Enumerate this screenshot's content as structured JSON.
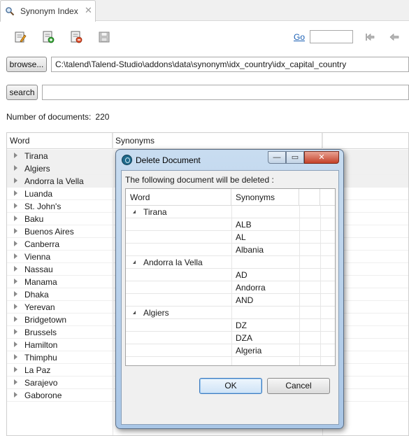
{
  "tab": {
    "title": "Synonym Index",
    "icon": "synonym-search-icon",
    "close": "✕"
  },
  "toolbar": {
    "icons": [
      "edit-document-icon",
      "add-document-icon",
      "delete-document-icon",
      "save-icon"
    ],
    "go_label": "Go",
    "go_value": "",
    "nav_icons": [
      "first-page-icon",
      "previous-page-icon"
    ]
  },
  "browse": {
    "button_label": "browse...",
    "path": "C:\\talend\\Talend-Studio\\addons\\data\\synonym\\idx_country\\idx_capital_country"
  },
  "search": {
    "button_label": "search",
    "value": ""
  },
  "document_count": {
    "label": "Number of documents:",
    "value": "220"
  },
  "table": {
    "columns": [
      "Word",
      "Synonyms"
    ],
    "rows": [
      "Tirana",
      "Algiers",
      "Andorra la Vella",
      "Luanda",
      "St. John's",
      "Baku",
      "Buenos Aires",
      "Canberra",
      "Vienna",
      "Nassau",
      "Manama",
      "Dhaka",
      "Yerevan",
      "Bridgetown",
      "Brussels",
      "Hamilton",
      "Thimphu",
      "La Paz",
      "Sarajevo",
      "Gaborone"
    ]
  },
  "dialog": {
    "title": "Delete Document",
    "window_buttons": {
      "minimize": "—",
      "maximize": "▭",
      "close": "✕"
    },
    "message": "The following document will be deleted :",
    "columns": [
      "Word",
      "Synonyms"
    ],
    "groups": [
      {
        "word": "Tirana",
        "synonyms": [
          "ALB",
          "AL",
          "Albania"
        ]
      },
      {
        "word": "Andorra la Vella",
        "synonyms": [
          "AD",
          "Andorra",
          "AND"
        ]
      },
      {
        "word": "Algiers",
        "synonyms": [
          "DZ",
          "DZA",
          "Algeria"
        ]
      }
    ],
    "ok_label": "OK",
    "cancel_label": "Cancel"
  },
  "colors": {
    "link": "#1a5fb4",
    "dialog_frame": "#a9c6e6",
    "ok_focus": "#3d7bbf"
  }
}
